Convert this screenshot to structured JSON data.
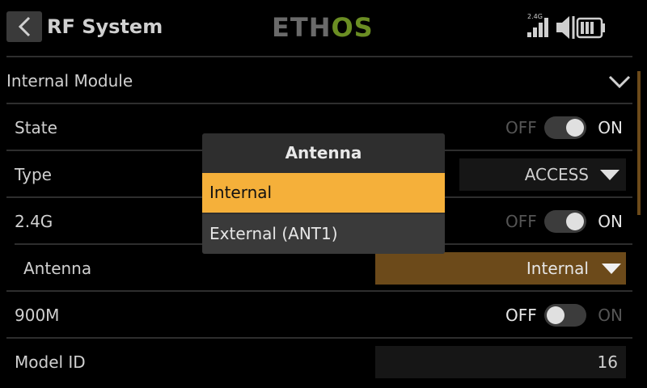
{
  "header": {
    "title": "RF System",
    "logo_left": "ETH",
    "logo_right": "OS",
    "signal_label": "2.4G",
    "accent": "#6b8e23"
  },
  "section": {
    "label": "Internal Module"
  },
  "rows": {
    "state": {
      "label": "State",
      "off": "OFF",
      "on": "ON",
      "value": true
    },
    "type": {
      "label": "Type",
      "value": "ACCESS"
    },
    "g24": {
      "label": "2.4G",
      "off": "OFF",
      "on": "ON",
      "value": true
    },
    "antenna": {
      "label": "Antenna",
      "value": "Internal",
      "color": "#6c4a1a"
    },
    "m900": {
      "label": "900M",
      "off": "OFF",
      "on": "ON",
      "value": false
    },
    "model_id": {
      "label": "Model ID",
      "value": "16"
    }
  },
  "modal": {
    "title": "Antenna",
    "options": [
      "Internal",
      "External (ANT1)"
    ],
    "selected": "Internal",
    "highlight_color": "#f5b03a"
  }
}
